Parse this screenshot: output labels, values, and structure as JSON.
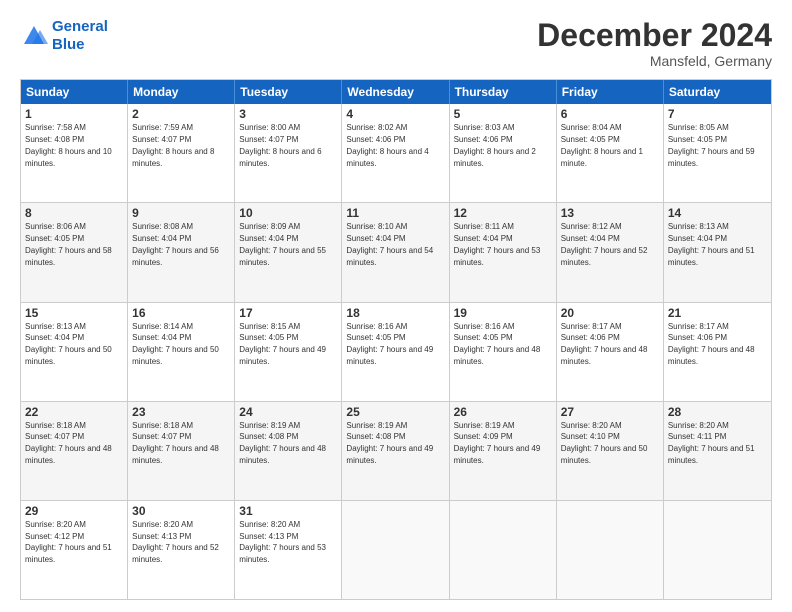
{
  "logo": {
    "line1": "General",
    "line2": "Blue"
  },
  "title": "December 2024",
  "subtitle": "Mansfeld, Germany",
  "header_days": [
    "Sunday",
    "Monday",
    "Tuesday",
    "Wednesday",
    "Thursday",
    "Friday",
    "Saturday"
  ],
  "weeks": [
    [
      {
        "day": "1",
        "sunrise": "7:58 AM",
        "sunset": "4:08 PM",
        "daylight": "8 hours and 10 minutes."
      },
      {
        "day": "2",
        "sunrise": "7:59 AM",
        "sunset": "4:07 PM",
        "daylight": "8 hours and 8 minutes."
      },
      {
        "day": "3",
        "sunrise": "8:00 AM",
        "sunset": "4:07 PM",
        "daylight": "8 hours and 6 minutes."
      },
      {
        "day": "4",
        "sunrise": "8:02 AM",
        "sunset": "4:06 PM",
        "daylight": "8 hours and 4 minutes."
      },
      {
        "day": "5",
        "sunrise": "8:03 AM",
        "sunset": "4:06 PM",
        "daylight": "8 hours and 2 minutes."
      },
      {
        "day": "6",
        "sunrise": "8:04 AM",
        "sunset": "4:05 PM",
        "daylight": "8 hours and 1 minute."
      },
      {
        "day": "7",
        "sunrise": "8:05 AM",
        "sunset": "4:05 PM",
        "daylight": "7 hours and 59 minutes."
      }
    ],
    [
      {
        "day": "8",
        "sunrise": "8:06 AM",
        "sunset": "4:05 PM",
        "daylight": "7 hours and 58 minutes."
      },
      {
        "day": "9",
        "sunrise": "8:08 AM",
        "sunset": "4:04 PM",
        "daylight": "7 hours and 56 minutes."
      },
      {
        "day": "10",
        "sunrise": "8:09 AM",
        "sunset": "4:04 PM",
        "daylight": "7 hours and 55 minutes."
      },
      {
        "day": "11",
        "sunrise": "8:10 AM",
        "sunset": "4:04 PM",
        "daylight": "7 hours and 54 minutes."
      },
      {
        "day": "12",
        "sunrise": "8:11 AM",
        "sunset": "4:04 PM",
        "daylight": "7 hours and 53 minutes."
      },
      {
        "day": "13",
        "sunrise": "8:12 AM",
        "sunset": "4:04 PM",
        "daylight": "7 hours and 52 minutes."
      },
      {
        "day": "14",
        "sunrise": "8:13 AM",
        "sunset": "4:04 PM",
        "daylight": "7 hours and 51 minutes."
      }
    ],
    [
      {
        "day": "15",
        "sunrise": "8:13 AM",
        "sunset": "4:04 PM",
        "daylight": "7 hours and 50 minutes."
      },
      {
        "day": "16",
        "sunrise": "8:14 AM",
        "sunset": "4:04 PM",
        "daylight": "7 hours and 50 minutes."
      },
      {
        "day": "17",
        "sunrise": "8:15 AM",
        "sunset": "4:05 PM",
        "daylight": "7 hours and 49 minutes."
      },
      {
        "day": "18",
        "sunrise": "8:16 AM",
        "sunset": "4:05 PM",
        "daylight": "7 hours and 49 minutes."
      },
      {
        "day": "19",
        "sunrise": "8:16 AM",
        "sunset": "4:05 PM",
        "daylight": "7 hours and 48 minutes."
      },
      {
        "day": "20",
        "sunrise": "8:17 AM",
        "sunset": "4:06 PM",
        "daylight": "7 hours and 48 minutes."
      },
      {
        "day": "21",
        "sunrise": "8:17 AM",
        "sunset": "4:06 PM",
        "daylight": "7 hours and 48 minutes."
      }
    ],
    [
      {
        "day": "22",
        "sunrise": "8:18 AM",
        "sunset": "4:07 PM",
        "daylight": "7 hours and 48 minutes."
      },
      {
        "day": "23",
        "sunrise": "8:18 AM",
        "sunset": "4:07 PM",
        "daylight": "7 hours and 48 minutes."
      },
      {
        "day": "24",
        "sunrise": "8:19 AM",
        "sunset": "4:08 PM",
        "daylight": "7 hours and 48 minutes."
      },
      {
        "day": "25",
        "sunrise": "8:19 AM",
        "sunset": "4:08 PM",
        "daylight": "7 hours and 49 minutes."
      },
      {
        "day": "26",
        "sunrise": "8:19 AM",
        "sunset": "4:09 PM",
        "daylight": "7 hours and 49 minutes."
      },
      {
        "day": "27",
        "sunrise": "8:20 AM",
        "sunset": "4:10 PM",
        "daylight": "7 hours and 50 minutes."
      },
      {
        "day": "28",
        "sunrise": "8:20 AM",
        "sunset": "4:11 PM",
        "daylight": "7 hours and 51 minutes."
      }
    ],
    [
      {
        "day": "29",
        "sunrise": "8:20 AM",
        "sunset": "4:12 PM",
        "daylight": "7 hours and 51 minutes."
      },
      {
        "day": "30",
        "sunrise": "8:20 AM",
        "sunset": "4:13 PM",
        "daylight": "7 hours and 52 minutes."
      },
      {
        "day": "31",
        "sunrise": "8:20 AM",
        "sunset": "4:13 PM",
        "daylight": "7 hours and 53 minutes."
      },
      {
        "day": "",
        "sunrise": "",
        "sunset": "",
        "daylight": ""
      },
      {
        "day": "",
        "sunrise": "",
        "sunset": "",
        "daylight": ""
      },
      {
        "day": "",
        "sunrise": "",
        "sunset": "",
        "daylight": ""
      },
      {
        "day": "",
        "sunrise": "",
        "sunset": "",
        "daylight": ""
      }
    ]
  ]
}
